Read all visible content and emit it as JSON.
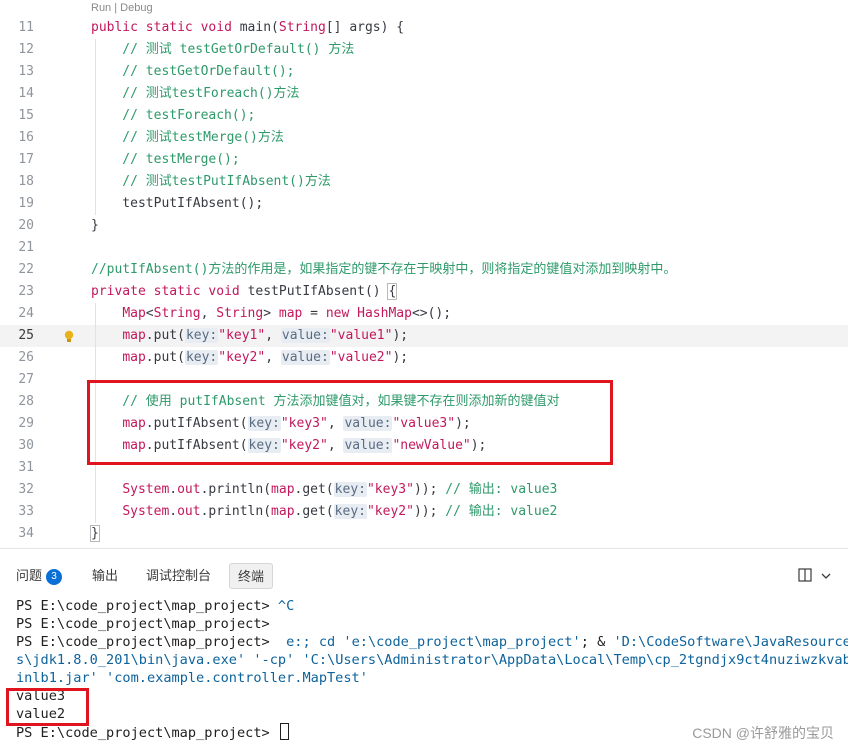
{
  "editor": {
    "codelens": "Run | Debug",
    "current_line": 25,
    "lines": [
      {
        "n": 11,
        "tokens": [
          [
            "kw",
            "public "
          ],
          [
            "kw",
            "static "
          ],
          [
            "kw",
            "void "
          ],
          [
            "pl",
            "main("
          ],
          [
            "type",
            "String"
          ],
          [
            "pl",
            "[] args) {"
          ]
        ],
        "indent": 0
      },
      {
        "n": 12,
        "tokens": [
          [
            "cm",
            "    // 测试 testGetOrDefault() 方法"
          ]
        ]
      },
      {
        "n": 13,
        "tokens": [
          [
            "cm",
            "    // testGetOrDefault();"
          ]
        ]
      },
      {
        "n": 14,
        "tokens": [
          [
            "cm",
            "    // 测试testForeach()方法"
          ]
        ]
      },
      {
        "n": 15,
        "tokens": [
          [
            "cm",
            "    // testForeach();"
          ]
        ]
      },
      {
        "n": 16,
        "tokens": [
          [
            "cm",
            "    // 测试testMerge()方法"
          ]
        ]
      },
      {
        "n": 17,
        "tokens": [
          [
            "cm",
            "    // testMerge();"
          ]
        ]
      },
      {
        "n": 18,
        "tokens": [
          [
            "cm",
            "    // 测试testPutIfAbsent()方法"
          ]
        ]
      },
      {
        "n": 19,
        "tokens": [
          [
            "pl",
            "    testPutIfAbsent();"
          ]
        ]
      },
      {
        "n": 20,
        "tokens": [
          [
            "pl",
            "}"
          ]
        ]
      },
      {
        "n": 21,
        "tokens": []
      },
      {
        "n": 22,
        "tokens": [
          [
            "cm",
            "//putIfAbsent()方法的作用是，如果指定的键不存在于映射中，则将指定的键值对添加到映射中。"
          ]
        ]
      },
      {
        "n": 23,
        "tokens": [
          [
            "kw",
            "private "
          ],
          [
            "kw",
            "static "
          ],
          [
            "kw",
            "void "
          ],
          [
            "pl",
            "testPutIfAbsent() "
          ],
          [
            "bracket",
            "{"
          ]
        ]
      },
      {
        "n": 24,
        "tokens": [
          [
            "pl",
            "    "
          ],
          [
            "type",
            "Map"
          ],
          [
            "pl",
            "<"
          ],
          [
            "type",
            "String"
          ],
          [
            "pl",
            ", "
          ],
          [
            "type",
            "String"
          ],
          [
            "pl",
            "> "
          ],
          [
            "var",
            "map"
          ],
          [
            "pl",
            " = "
          ],
          [
            "kw",
            "new "
          ],
          [
            "type",
            "HashMap"
          ],
          [
            "pl",
            "<>();"
          ]
        ]
      },
      {
        "n": 25,
        "tokens": [
          [
            "pl",
            "    "
          ],
          [
            "var",
            "map"
          ],
          [
            "pl",
            ".put("
          ],
          [
            "hint",
            "key:"
          ],
          [
            "str",
            "\"key1\""
          ],
          [
            "pl",
            ", "
          ],
          [
            "hint",
            "value:"
          ],
          [
            "str",
            "\"value1\""
          ],
          [
            "pl",
            ");"
          ]
        ]
      },
      {
        "n": 26,
        "tokens": [
          [
            "pl",
            "    "
          ],
          [
            "var",
            "map"
          ],
          [
            "pl",
            ".put("
          ],
          [
            "hint",
            "key:"
          ],
          [
            "str",
            "\"key2\""
          ],
          [
            "pl",
            ", "
          ],
          [
            "hint",
            "value:"
          ],
          [
            "str",
            "\"value2\""
          ],
          [
            "pl",
            ");"
          ]
        ]
      },
      {
        "n": 27,
        "tokens": []
      },
      {
        "n": 28,
        "tokens": [
          [
            "cm",
            "    // 使用 putIfAbsent 方法添加键值对，如果键不存在则添加新的键值对"
          ]
        ]
      },
      {
        "n": 29,
        "tokens": [
          [
            "pl",
            "    "
          ],
          [
            "var",
            "map"
          ],
          [
            "pl",
            ".putIfAbsent("
          ],
          [
            "hint",
            "key:"
          ],
          [
            "str",
            "\"key3\""
          ],
          [
            "pl",
            ", "
          ],
          [
            "hint",
            "value:"
          ],
          [
            "str",
            "\"value3\""
          ],
          [
            "pl",
            ");"
          ]
        ]
      },
      {
        "n": 30,
        "tokens": [
          [
            "pl",
            "    "
          ],
          [
            "var",
            "map"
          ],
          [
            "pl",
            ".putIfAbsent("
          ],
          [
            "hint",
            "key:"
          ],
          [
            "str",
            "\"key2\""
          ],
          [
            "pl",
            ", "
          ],
          [
            "hint",
            "value:"
          ],
          [
            "str",
            "\"newValue\""
          ],
          [
            "pl",
            ");"
          ]
        ]
      },
      {
        "n": 31,
        "tokens": []
      },
      {
        "n": 32,
        "tokens": [
          [
            "pl",
            "    "
          ],
          [
            "type",
            "System"
          ],
          [
            "pl",
            "."
          ],
          [
            "field",
            "out"
          ],
          [
            "pl",
            ".println("
          ],
          [
            "var",
            "map"
          ],
          [
            "pl",
            ".get("
          ],
          [
            "hint",
            "key:"
          ],
          [
            "str",
            "\"key3\""
          ],
          [
            "pl",
            "));"
          ],
          [
            "cm",
            " // 输出: value3"
          ]
        ]
      },
      {
        "n": 33,
        "tokens": [
          [
            "pl",
            "    "
          ],
          [
            "type",
            "System"
          ],
          [
            "pl",
            "."
          ],
          [
            "field",
            "out"
          ],
          [
            "pl",
            ".println("
          ],
          [
            "var",
            "map"
          ],
          [
            "pl",
            ".get("
          ],
          [
            "hint",
            "key:"
          ],
          [
            "str",
            "\"key2\""
          ],
          [
            "pl",
            "));"
          ],
          [
            "cm",
            " // 输出: value2"
          ]
        ]
      },
      {
        "n": 34,
        "tokens": [
          [
            "bracket",
            "}"
          ]
        ]
      }
    ]
  },
  "panel": {
    "tabs": [
      {
        "label": "问题",
        "badge": "3"
      },
      {
        "label": "输出"
      },
      {
        "label": "调试控制台"
      },
      {
        "label": "终端",
        "active": true
      }
    ],
    "tools": {
      "layout_icon": "split-panel-icon",
      "chevron_icon": "chevron-down-icon"
    }
  },
  "terminal": {
    "lines": [
      [
        [
          "pl",
          "PS E:\\code_project\\map_project> "
        ],
        [
          "s",
          "^C"
        ]
      ],
      [
        [
          "pl",
          "PS E:\\code_project\\map_project>"
        ]
      ],
      [
        [
          "pl",
          "PS E:\\code_project\\map_project> "
        ],
        [
          "s",
          " e:; cd "
        ],
        [
          "s",
          "'e:\\code_project\\map_project'"
        ],
        [
          "pl",
          "; & "
        ],
        [
          "s",
          "'D:\\CodeSoftware\\JavaResource"
        ]
      ],
      [
        [
          "s",
          "s\\jdk1.8.0_201\\bin\\java.exe'"
        ],
        [
          "pl",
          " "
        ],
        [
          "s",
          "'-cp'"
        ],
        [
          "pl",
          " "
        ],
        [
          "s",
          "'C:\\Users\\Administrator\\AppData\\Local\\Temp\\cp_2tgndjx9ct4nuziwzkvab"
        ]
      ],
      [
        [
          "s",
          "inlb1.jar'"
        ],
        [
          "pl",
          " "
        ],
        [
          "s",
          "'com.example.controller.MapTest'"
        ]
      ],
      [
        [
          "pl",
          "value3"
        ]
      ],
      [
        [
          "pl",
          "value2"
        ]
      ],
      [
        [
          "pl",
          "PS E:\\code_project\\map_project> "
        ]
      ]
    ],
    "watermark": "CSDN @许舒雅的宝贝"
  }
}
